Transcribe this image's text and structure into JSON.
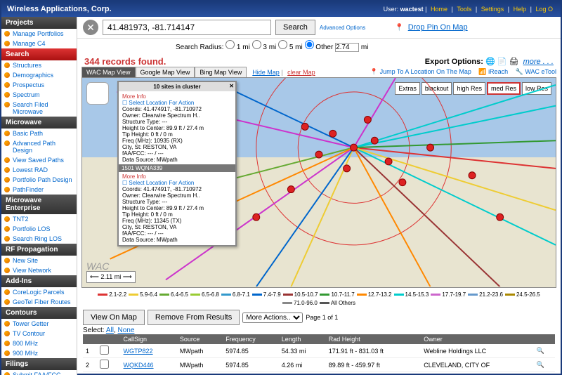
{
  "header": {
    "brand": "Wireless Applications, Corp.",
    "user_label": "User:",
    "username": "wactest",
    "links": [
      "Home",
      "Tools",
      "Settings",
      "Help",
      "Log O"
    ]
  },
  "sidebar": {
    "sections": [
      {
        "title": "Projects",
        "cls": "",
        "items": [
          "Manage Portfolios",
          "Manage C4"
        ]
      },
      {
        "title": "Search",
        "cls": "search",
        "items": [
          "Structures",
          "Demographics",
          "Prospectus",
          "Spectrum",
          "Search Filed Microwave"
        ]
      },
      {
        "title": "Microwave",
        "cls": "",
        "items": [
          "Basic Path",
          "Advanced Path Design",
          "View Saved Paths",
          "Lowest RAD",
          "Portfolio Path Design",
          "PathFinder"
        ]
      },
      {
        "title": "Microwave Enterprise",
        "cls": "",
        "items": [
          "TNT2",
          "Portfolio LOS",
          "Search Ring LOS"
        ]
      },
      {
        "title": "RF Propagation",
        "cls": "",
        "items": [
          "New Site",
          "View Network"
        ]
      },
      {
        "title": "Add-Ins",
        "cls": "",
        "items": [
          "CoreLogic Parcels",
          "GeoTel Fiber Routes"
        ]
      },
      {
        "title": "Contours",
        "cls": "",
        "items": [
          "Tower Getter",
          "TV Contour",
          "800 MHz",
          "900 MHz"
        ]
      },
      {
        "title": "Filings",
        "cls": "",
        "items": [
          "Submit FAA/FCC"
        ]
      }
    ]
  },
  "search": {
    "coords": "41.481973, -81.714147",
    "button": "Search",
    "adv": "Advanced Options",
    "drop": "Drop Pin On Map",
    "radius_label": "Search Radius:",
    "radius_opts": [
      "1 mi",
      "3 mi",
      "5 mi",
      "Other"
    ],
    "radius_val": "2.74",
    "radius_unit": "mi"
  },
  "results": {
    "found": "344 records found.",
    "export_label": "Export Options:",
    "more": "more . . ."
  },
  "tabs": {
    "items": [
      "WAC Map View",
      "Google Map View",
      "Bing Map View"
    ],
    "hide": "Hide Map",
    "clear": "clear Map"
  },
  "maplinks": {
    "jump": "Jump To A Location On The Map",
    "ireach": "iReach",
    "etool": "WAC eTool"
  },
  "resbtns": [
    "Extras",
    "blackout",
    "high Res",
    "med Res",
    "low Res"
  ],
  "resbtn_sel": 3,
  "scale": "2.11 mi",
  "watermark": "WAC",
  "cluster": {
    "title": "10 sites in cluster",
    "more": "More Info",
    "select": "Select Location For Action",
    "site1": {
      "coords": "Coords: 41.474917, -81.710972",
      "owner": "Owner: Clearwire Spectrum H..",
      "stype": "Structure Type: ---",
      "htc": "Height to Center: 89.9 ft / 27.4 m",
      "tip": "Tip Height: 0 ft / 0 m",
      "freq": "Freq (MHz): 10935 (RX)",
      "city": "City, St: RESTON, VA",
      "faa": "fAA/FCC: --- / ---",
      "src": "Data Source: MWpath"
    },
    "sep": "1501 WQNA339",
    "site2": {
      "coords": "Coords: 41.474917, -81.710972",
      "owner": "Owner: Clearwire Spectrum H..",
      "stype": "Structure Type: ---",
      "htc": "Height to Center: 89.9 ft / 27.4 m",
      "tip": "Tip Height: 0 ft / 0 m",
      "freq": "Freq (MHz): 11345 (TX)",
      "city": "City, St: RESTON, VA",
      "faa": "fAA/FCC: --- / ---",
      "src": "Data Source: MWpath"
    }
  },
  "legend": [
    {
      "c": "#d33",
      "t": "2.1-2.2"
    },
    {
      "c": "#ec3",
      "t": "5.9-6.4"
    },
    {
      "c": "#6a3",
      "t": "6.4-6.5"
    },
    {
      "c": "#9c3",
      "t": "6.5-6.8"
    },
    {
      "c": "#39c",
      "t": "6.8-7.1"
    },
    {
      "c": "#06c",
      "t": "7.4-7.9"
    },
    {
      "c": "#933",
      "t": "10.5-10.7"
    },
    {
      "c": "#393",
      "t": "10.7-11.7"
    },
    {
      "c": "#f80",
      "t": "12.7-13.2"
    },
    {
      "c": "#0cc",
      "t": "14.5-15.3"
    },
    {
      "c": "#c6c",
      "t": "17.7-19.7"
    },
    {
      "c": "#69c",
      "t": "21.2-23.6"
    },
    {
      "c": "#a80",
      "t": "24.5-26.5"
    },
    {
      "c": "#888",
      "t": "71.0-96.0"
    },
    {
      "c": "#555",
      "t": "All Others"
    }
  ],
  "grid": {
    "view": "View On Map",
    "remove": "Remove From Results",
    "more": "More Actions..",
    "select_lbl": "Select:",
    "all": "All",
    "none": "None",
    "pager": "Page 1 of 1",
    "cols": [
      "",
      "",
      "CallSign",
      "Source",
      "Frequency",
      "Length",
      "Rad Height",
      "Owner",
      ""
    ],
    "rows": [
      {
        "n": "1",
        "cs": "WGTP822",
        "src": "MWpath",
        "freq": "5974.85",
        "len": "54.33 mi",
        "rad": "171.91 ft - 831.03 ft",
        "own": "Webline Holdings LLC"
      },
      {
        "n": "2",
        "cs": "WQKD446",
        "src": "MWpath",
        "freq": "5974.85",
        "len": "4.26 mi",
        "rad": "89.89 ft - 459.97 ft",
        "own": "CLEVELAND, CITY OF"
      }
    ]
  }
}
